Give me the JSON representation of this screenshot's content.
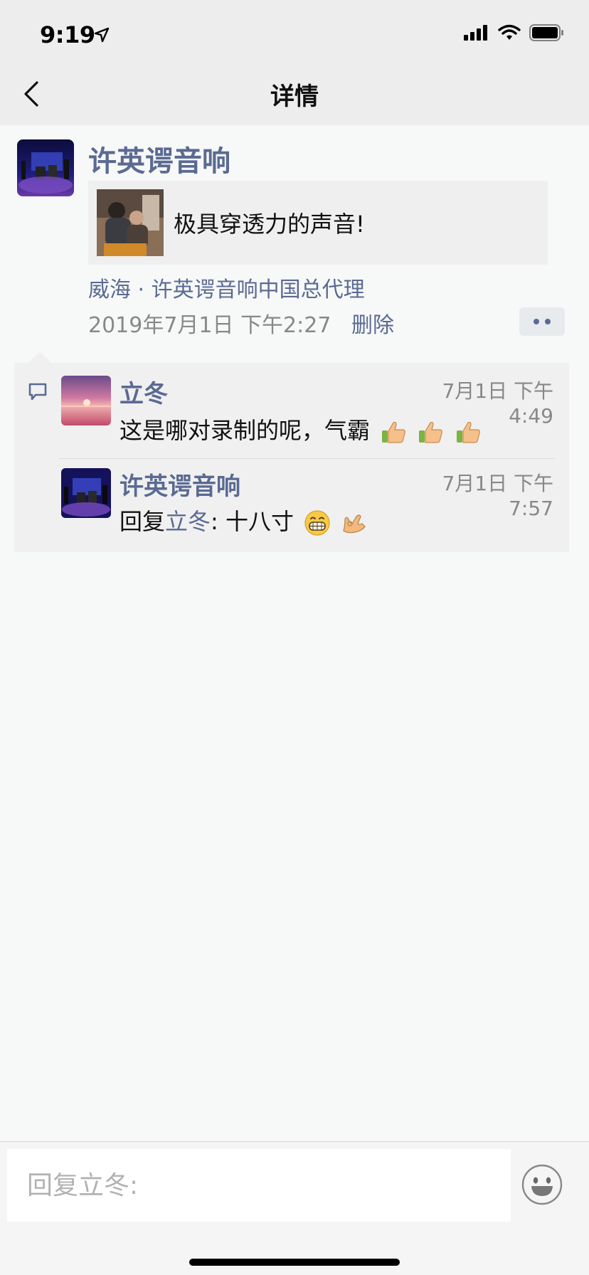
{
  "status_bar": {
    "time": "9:19"
  },
  "nav": {
    "title": "详情"
  },
  "post": {
    "author": "许英谔音响",
    "link_text": "极具穿透力的声音!",
    "location": "威海 · 许英谔音响中国总代理",
    "timestamp": "2019年7月1日 下午2:27",
    "delete_label": "删除"
  },
  "comments": [
    {
      "name": "立冬",
      "time": "7月1日 下午4:49",
      "text": "这是哪对录制的呢，气霸",
      "emojis": [
        "thumbs-up",
        "thumbs-up",
        "thumbs-up"
      ]
    },
    {
      "name": "许英谔音响",
      "time": "7月1日 下午7:57",
      "reply_prefix": "回复",
      "reply_to": "立冬",
      "text": ": 十八寸",
      "emojis": [
        "grinning-face",
        "ok-hand"
      ]
    }
  ],
  "reply_bar": {
    "placeholder": "回复立冬:"
  },
  "colors": {
    "link_blue": "#5a6a92",
    "nav_bg": "#ededed",
    "page_bg": "#f7f8f8"
  }
}
